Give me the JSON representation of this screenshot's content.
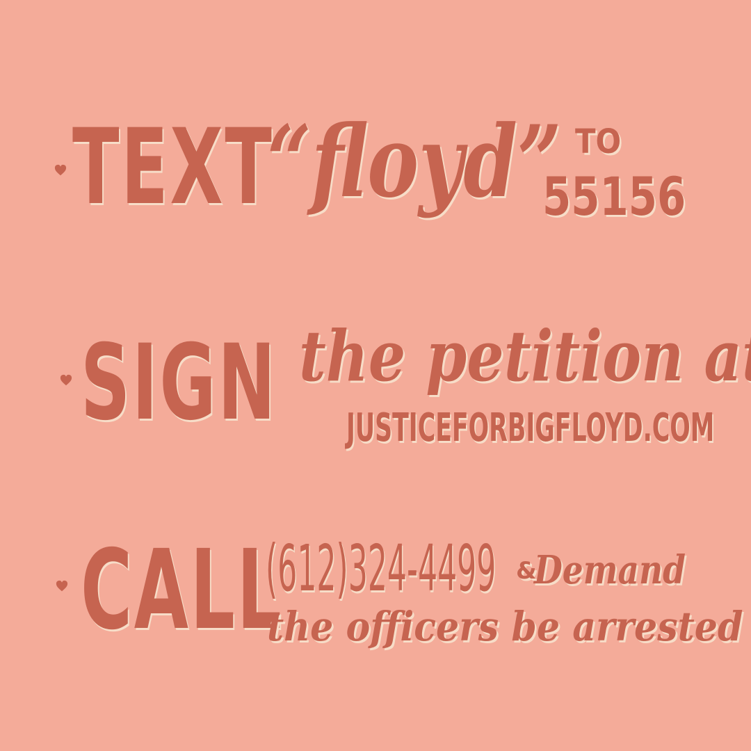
{
  "background_color": "#f4ab99",
  "text_color": "#c66450",
  "shadow_color": "#f7ddc8",
  "bullet_icon": "heart-icon",
  "items": [
    {
      "action": "TEXT",
      "keyword": "“floyd”",
      "to_label": "TO",
      "number": "55156"
    },
    {
      "action": "SIGN",
      "phrase": "the petition at",
      "website": "JUSTICEFORBIGFLOYD.COM"
    },
    {
      "action": "CALL",
      "phone": "(612)324-4499",
      "amp_label": "&",
      "demand": "Demand",
      "message": "the officers be arrested !"
    }
  ]
}
